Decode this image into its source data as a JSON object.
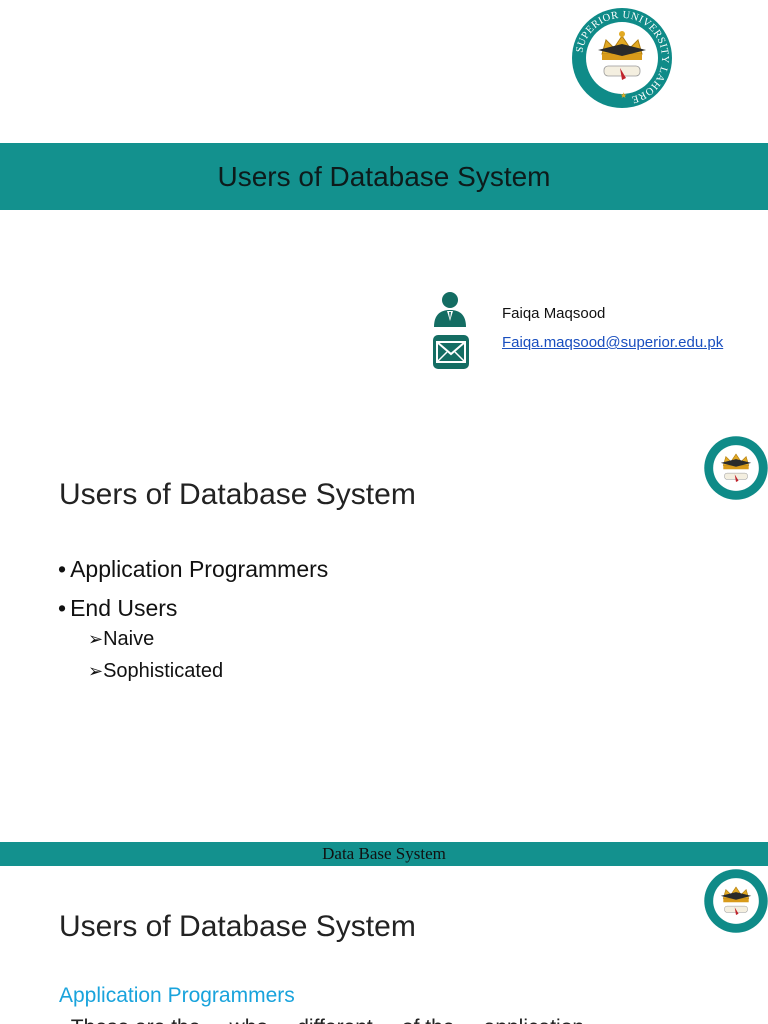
{
  "slide1": {
    "logo": {
      "icon": "superior-university-seal-icon",
      "text": "SUPERIOR UNIVERSITY LAHORE",
      "colors": {
        "ring": "#0f8b88",
        "crown": "#e2a923"
      }
    },
    "title": "Users of Database System",
    "author": {
      "name": "Faiqa Maqsood",
      "email": "Faiqa.maqsood@superior.edu.pk",
      "icons": [
        "person-icon",
        "envelope-icon"
      ]
    },
    "band_color": "#13918e"
  },
  "slide2": {
    "heading": "Users of Database System",
    "bullets": [
      "Application Programmers",
      "End Users"
    ],
    "sub_bullets": [
      "Naive",
      "Sophisticated"
    ],
    "footer": "Data Base System"
  },
  "slide3": {
    "heading": "Users of Database System",
    "subheading": "Application Programmers",
    "partial_line": "• These are the ... who ... different ... of the ... application"
  }
}
